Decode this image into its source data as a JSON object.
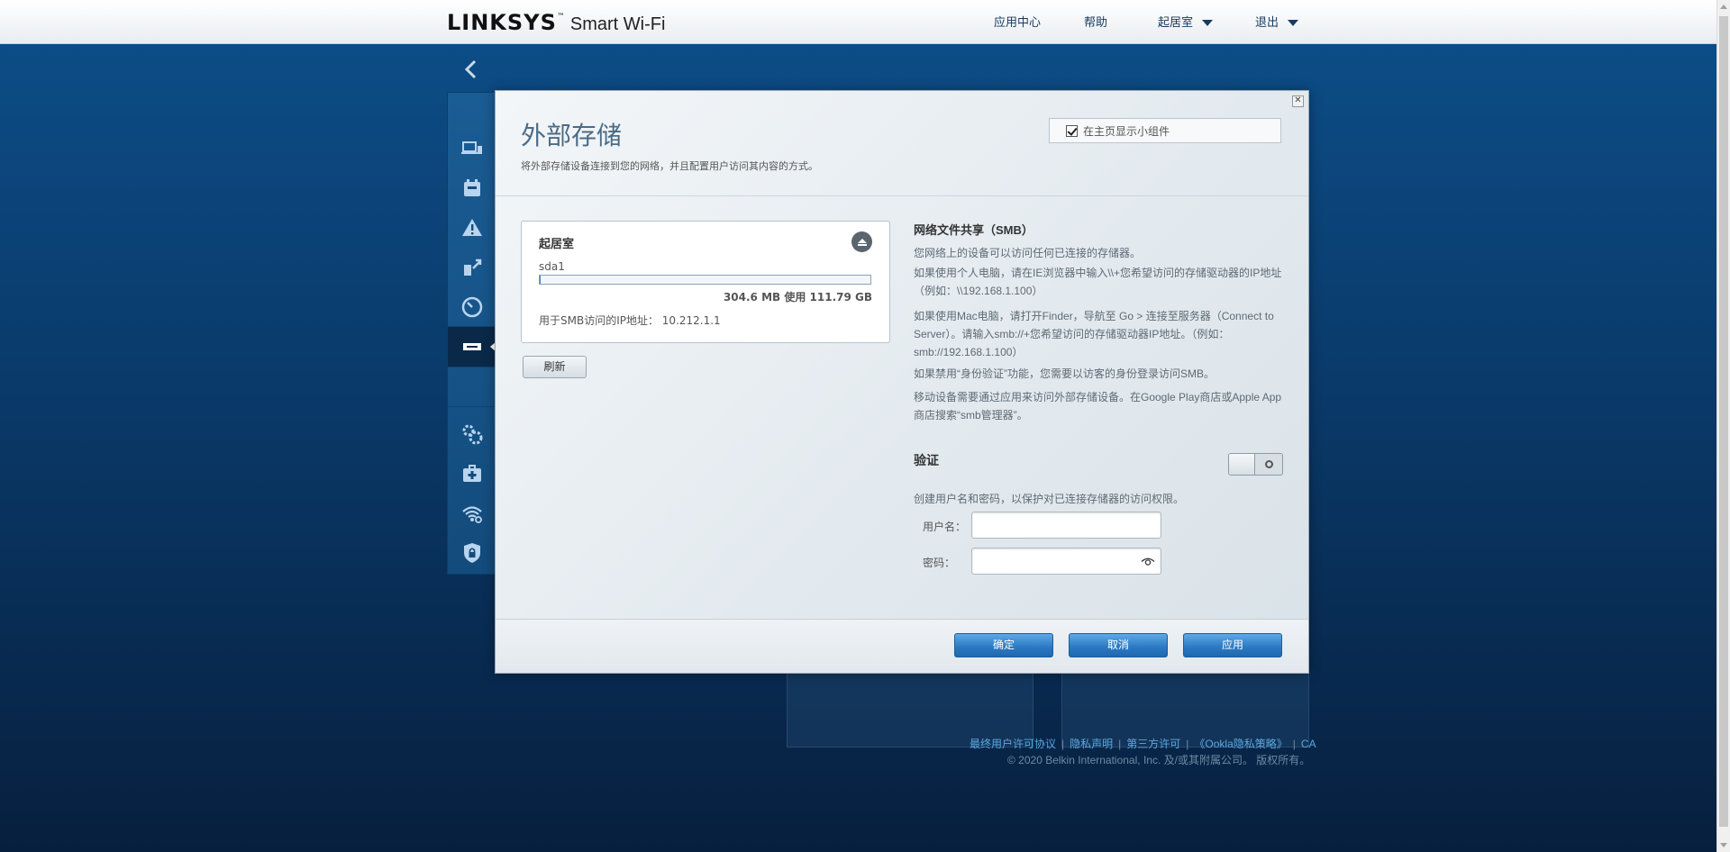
{
  "header": {
    "brand": "LINKSYS",
    "trademark": "™",
    "product": "Smart Wi-Fi",
    "nav": [
      {
        "label": "应用中心"
      },
      {
        "label": "帮助"
      },
      {
        "label": "起居室"
      },
      {
        "label": "退出"
      }
    ]
  },
  "sidebar": {
    "icons": [
      "chevron-left-icon",
      "devices-icon",
      "parental-controls-icon",
      "alert-icon",
      "prioritization-icon",
      "speed-test-icon",
      "usb-storage-icon",
      "settings-icon",
      "troubleshooting-icon",
      "wifi-settings-icon",
      "security-icon"
    ],
    "active": "usb-storage-icon"
  },
  "modal": {
    "title": "外部存储",
    "subtitle": "将外部存储设备连接到您的网络，并且配置用户访问其内容的方式。",
    "show_widget_label": "在主页显示小组件",
    "show_widget_checked": true,
    "close_symbol": "✕",
    "storage": {
      "device_name": "起居室",
      "drive": "sda1",
      "usage_fraction": 0.003,
      "usage_text": "304.6 MB 使用 111.79 GB",
      "ip_text": "用于SMB访问的IP地址：  10.212.1.1"
    },
    "refresh_label": "刷新",
    "smb": {
      "title": "网络文件共享（SMB）",
      "p1": "您网络上的设备可以访问任何已连接的存储器。",
      "p2": "如果使用个人电脑，请在IE浏览器中输入\\\\+您希望访问的存储驱动器的IP地址（例如：\\\\192.168.1.100）",
      "p3": "如果使用Mac电脑，请打开Finder，导航至 Go > 连接至服务器（Connect to Server）。请输入smb://+您希望访问的存储驱动器IP地址。（例如：smb://192.168.1.100）",
      "p4": "如果禁用“身份验证”功能，您需要以访客的身份登录访问SMB。",
      "p5": "移动设备需要通过应用来访问外部存储设备。在Google Play商店或Apple App商店搜索“smb管理器”。"
    },
    "auth": {
      "title": "验证",
      "enabled": false,
      "description": "创建用户名和密码，以保护对已连接存储器的访问权限。",
      "username_label": "用户名：",
      "username_value": "",
      "password_label": "密码：",
      "password_value": ""
    },
    "buttons": {
      "ok": "确定",
      "cancel": "取消",
      "apply": "应用"
    }
  },
  "footer": {
    "links": [
      "最终用户许可协议",
      "隐私声明",
      "第三方许可",
      "《Ookla隐私策略》",
      "CA"
    ],
    "copyright": "© 2020 Belkin International, Inc. 及/或其附属公司。 版权所有。"
  },
  "colors": {
    "accent": "#2a78c2",
    "background": "#0a3a6a",
    "title": "#4b6b86"
  }
}
